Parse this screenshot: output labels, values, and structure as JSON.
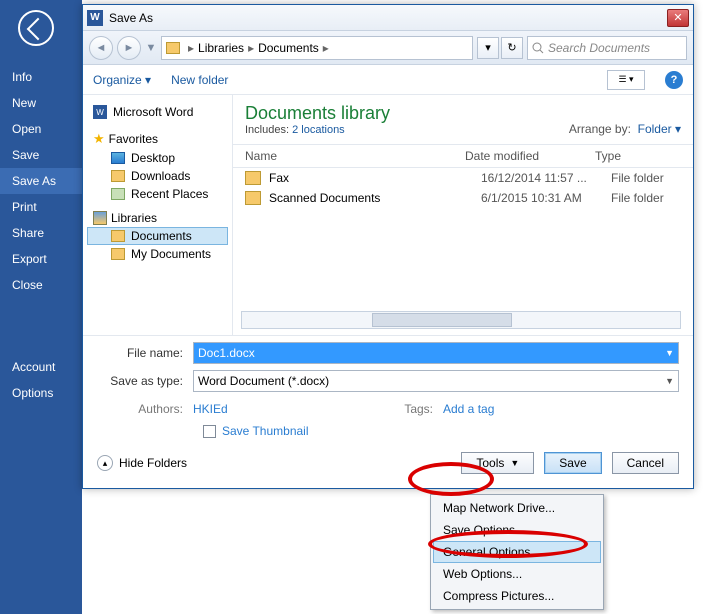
{
  "backstage": {
    "items": [
      "Info",
      "New",
      "Open",
      "Save",
      "Save As",
      "Print",
      "Share",
      "Export",
      "Close"
    ],
    "footer": [
      "Account",
      "Options"
    ],
    "selected_index": 4
  },
  "dialog": {
    "title": "Save As",
    "crumbs": [
      "Libraries",
      "Documents"
    ],
    "search_placeholder": "Search Documents",
    "toolbar": {
      "organize": "Organize",
      "newfolder": "New folder"
    },
    "tree": {
      "word": "Microsoft Word",
      "favorites": "Favorites",
      "fav_items": [
        "Desktop",
        "Downloads",
        "Recent Places"
      ],
      "libraries": "Libraries",
      "lib_items": [
        "Documents",
        "My Documents"
      ],
      "selected": "Documents"
    },
    "library": {
      "title": "Documents library",
      "includes_label": "Includes:",
      "includes_link": "2 locations",
      "arrange_label": "Arrange by:",
      "arrange_value": "Folder"
    },
    "columns": {
      "name": "Name",
      "modified": "Date modified",
      "type": "Type"
    },
    "files": [
      {
        "name": "Fax",
        "modified": "16/12/2014 11:57 ...",
        "type": "File folder"
      },
      {
        "name": "Scanned Documents",
        "modified": "6/1/2015 10:31 AM",
        "type": "File folder"
      }
    ],
    "form": {
      "filename_label": "File name:",
      "filename_value": "Doc1.docx",
      "saveastype_label": "Save as type:",
      "saveastype_value": "Word Document (*.docx)",
      "authors_label": "Authors:",
      "authors_value": "HKIEd",
      "tags_label": "Tags:",
      "tags_value": "Add a tag",
      "save_thumbnail": "Save Thumbnail"
    },
    "buttons": {
      "hide_folders": "Hide Folders",
      "tools": "Tools",
      "save": "Save",
      "cancel": "Cancel"
    },
    "tools_menu": [
      "Map Network Drive...",
      "Save Options...",
      "General Options...",
      "Web Options...",
      "Compress Pictures..."
    ],
    "tools_hover_index": 2
  }
}
